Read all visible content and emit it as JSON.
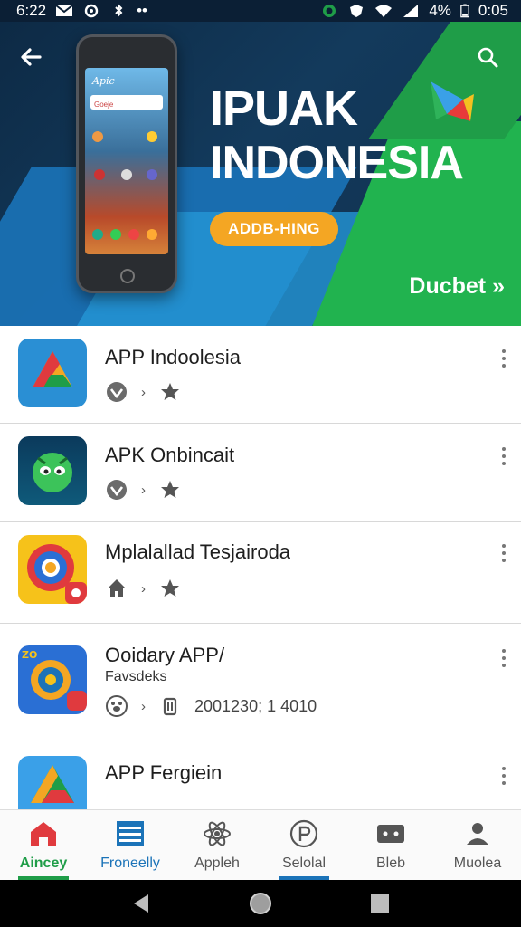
{
  "status_bar": {
    "time": "6:22",
    "battery": "4%",
    "clock": "0:05"
  },
  "hero": {
    "title_line1": "IPUAK",
    "title_line2": "INDONESIA",
    "cta_label": "ADDB-HING",
    "brand": "Ducbet",
    "phone_search": "Goeje",
    "phone_app": "Apic"
  },
  "apps": [
    {
      "title": "APP Indoolesia",
      "subtitle": "",
      "meta": ""
    },
    {
      "title": "APK Onbincait",
      "subtitle": "",
      "meta": ""
    },
    {
      "title": "Mplalallad Tesjairoda",
      "subtitle": "",
      "meta": ""
    },
    {
      "title": "Ooidary APP/",
      "subtitle": "Favsdeks",
      "meta": "2001230; 1 4010"
    },
    {
      "title": "APP Fergiein",
      "subtitle": "",
      "meta": ""
    }
  ],
  "bottom_nav": [
    {
      "label": "Aincey",
      "color": "#e03a3e"
    },
    {
      "label": "Froneelly",
      "color": "#1b73b8"
    },
    {
      "label": "Appleh",
      "color": "#555555"
    },
    {
      "label": "Selolal",
      "color": "#555555"
    },
    {
      "label": "Bleb",
      "color": "#555555"
    },
    {
      "label": "Muolea",
      "color": "#555555"
    }
  ],
  "colors": {
    "accent_green": "#1f9d48",
    "accent_blue": "#1b73b8",
    "cta_orange": "#f4a623"
  }
}
